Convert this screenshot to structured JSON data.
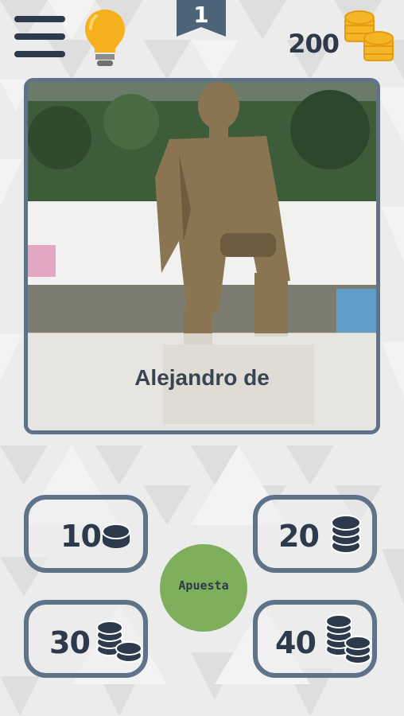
{
  "header": {
    "menu_icon": "hamburger-menu-icon",
    "hint_icon": "lightbulb-icon",
    "level": "1",
    "score": "200",
    "coins_icon": "coin-stack-icon"
  },
  "photo": {
    "caption": "Alejandro de"
  },
  "bets": [
    {
      "amount": "10",
      "icon": "single-coin-icon"
    },
    {
      "amount": "20",
      "icon": "coin-stack-icon"
    },
    {
      "amount": "30",
      "icon": "coin-stacks-icon"
    },
    {
      "amount": "40",
      "icon": "coin-stacks-icon"
    }
  ],
  "center_button": {
    "label": "Apuesta",
    "color": "#7daf5d"
  },
  "colors": {
    "accent": "#5f7388",
    "text": "#2d3a4c",
    "bulb": "#f5b11d",
    "coins": "#f4b526"
  }
}
